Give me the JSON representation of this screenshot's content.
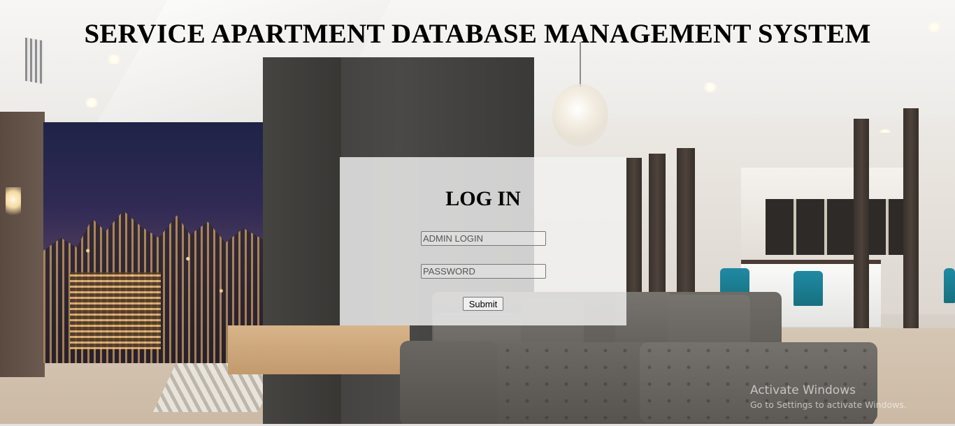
{
  "header": {
    "title": "SERVICE APARTMENT DATABASE MANAGEMENT SYSTEM"
  },
  "login": {
    "title": "LOG IN",
    "username_placeholder": "ADMIN LOGIN",
    "username_value": "",
    "password_placeholder": "PASSWORD",
    "password_value": "",
    "submit_label": "Submit"
  },
  "watermark": {
    "title": "Activate Windows",
    "subtitle": "Go to Settings to activate Windows."
  },
  "colors": {
    "panel_background": "#f2f2f2",
    "title_text": "#000000",
    "accent_chair": "#1f8aa4"
  }
}
